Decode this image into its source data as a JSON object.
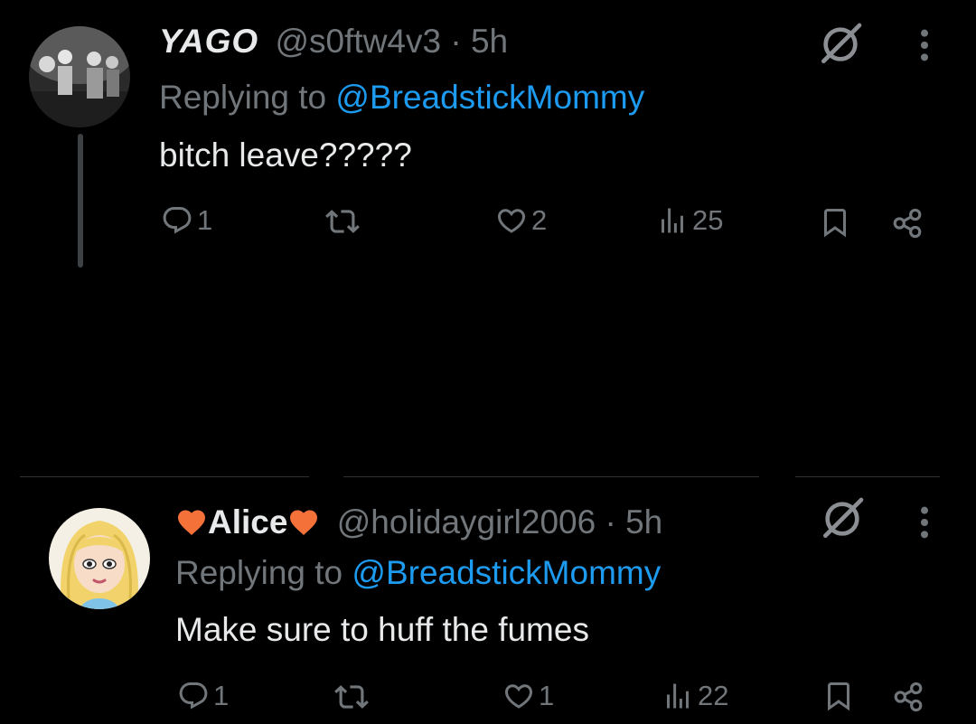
{
  "tweets": [
    {
      "author_name": "YAGO",
      "handle": "@s0ftw4v3",
      "separator": "·",
      "time": "5h",
      "replying_prefix": "Replying to ",
      "replying_to": "@BreadstickMommy",
      "text": "bitch leave?????",
      "replies": "1",
      "likes": "2",
      "views": "25"
    },
    {
      "author_name": "Alice",
      "handle": "@holidaygirl2006",
      "separator": "·",
      "time": "5h",
      "replying_prefix": "Replying to ",
      "replying_to": "@BreadstickMommy",
      "text": "Make sure to huff the fumes",
      "replies": "1",
      "likes": "1",
      "views": "22"
    }
  ],
  "icons": {
    "reply": "reply-icon",
    "retweet": "retweet-icon",
    "like": "like-icon",
    "views": "views-icon",
    "bookmark": "bookmark-icon",
    "share": "share-icon",
    "grok": "grok-icon",
    "more": "more-icon",
    "name_decoration": "orange-heart-icon"
  },
  "colors": {
    "background": "#000000",
    "text_primary": "#e7e9ea",
    "text_secondary": "#71767b",
    "link": "#1d9bf0",
    "heart_accent": "#f4713a"
  }
}
